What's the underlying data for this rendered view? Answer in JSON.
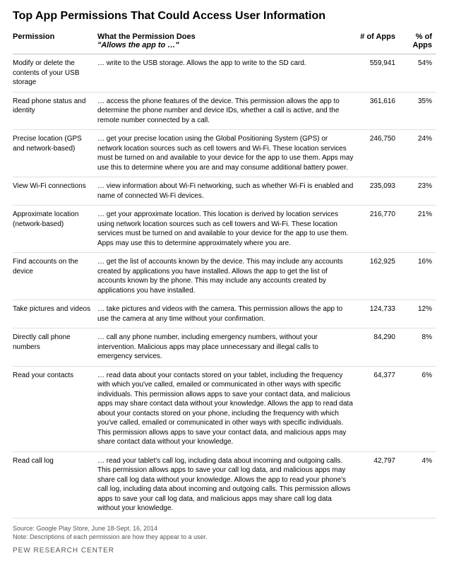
{
  "title": "Top App Permissions That Could Access User Information",
  "headers": {
    "permission": "Permission",
    "does_label": "What the Permission Does",
    "does_sub": "\"Allows the app to …\"",
    "num_apps": "# of Apps",
    "pct_apps": "% of Apps"
  },
  "rows": [
    {
      "permission": "Modify or delete the contents of your USB storage",
      "description": "… write to the USB storage. Allows the app to write to the SD card.",
      "num": "559,941",
      "pct": "54%"
    },
    {
      "permission": "Read phone status and identity",
      "description": "… access the phone features of the device. This permission allows the app to determine the phone number and device IDs, whether a call is active, and the remote number connected by a call.",
      "num": "361,616",
      "pct": "35%"
    },
    {
      "permission": "Precise location (GPS and network-based)",
      "description": "… get your precise location using the Global Positioning System (GPS) or network location sources such as cell towers and Wi-Fi. These location services must be turned on and available to your device for the app to use them. Apps may use this to determine where you are and may consume additional battery power.",
      "num": "246,750",
      "pct": "24%"
    },
    {
      "permission": "View Wi-Fi connections",
      "description": "… view information about Wi-Fi networking, such as whether Wi-Fi is enabled and name of connected Wi-Fi devices.",
      "num": "235,093",
      "pct": "23%"
    },
    {
      "permission": "Approximate location (network-based)",
      "description": "… get your approximate location. This location is derived by location services using network location sources such as cell towers and Wi-Fi. These location services must be turned on and available to your device for the app to use them. Apps may use this to determine approximately where you are.",
      "num": "216,770",
      "pct": "21%"
    },
    {
      "permission": "Find accounts on the device",
      "description": "… get the list of accounts known by the device. This may include any accounts created by applications you have installed. Allows the app to get the list of accounts known by the phone. This may include any accounts created by applications you have installed.",
      "num": "162,925",
      "pct": "16%"
    },
    {
      "permission": "Take pictures and videos",
      "description": "… take pictures and videos with the camera. This permission allows the app to use the camera at any time without your confirmation.",
      "num": "124,733",
      "pct": "12%"
    },
    {
      "permission": "Directly call phone numbers",
      "description": "… call any phone number, including emergency numbers, without your intervention. Malicious apps may place unnecessary and illegal calls to emergency services.",
      "num": "84,290",
      "pct": "8%"
    },
    {
      "permission": "Read your contacts",
      "description": "… read data about your contacts stored on your tablet, including the frequency with which you've called, emailed or communicated in other ways with specific individuals. This permission allows apps to save your contact data, and malicious apps may share contact data without your knowledge. Allows the app to read data about your contacts stored on your phone, including the frequency with which you've called, emailed or communicated in other ways with specific individuals. This permission allows apps to save your contact data, and malicious apps may share contact data without your knowledge.",
      "num": "64,377",
      "pct": "6%"
    },
    {
      "permission": "Read call log",
      "description": "… read your tablet's call log, including data about incoming and outgoing calls. This permission allows apps to save your call log data, and malicious apps may share call log data without your knowledge. Allows the app to read your phone's call log, including data about incoming and outgoing calls. This permission allows apps to save your call log data, and malicious apps may share call log data without your knowledge.",
      "num": "42,797",
      "pct": "4%"
    }
  ],
  "footer": {
    "source": "Source: Google Play Store, June 18-Sept. 16, 2014",
    "note": "Note: Descriptions of each permission are how they appear to a user.",
    "org": "PEW RESEARCH CENTER"
  },
  "chart_data": {
    "type": "table",
    "title": "Top App Permissions That Could Access User Information",
    "columns": [
      "Permission",
      "# of Apps",
      "% of Apps"
    ],
    "rows": [
      [
        "Modify or delete the contents of your USB storage",
        559941,
        54
      ],
      [
        "Read phone status and identity",
        361616,
        35
      ],
      [
        "Precise location (GPS and network-based)",
        246750,
        24
      ],
      [
        "View Wi-Fi connections",
        235093,
        23
      ],
      [
        "Approximate location (network-based)",
        216770,
        21
      ],
      [
        "Find accounts on the device",
        162925,
        16
      ],
      [
        "Take pictures and videos",
        124733,
        12
      ],
      [
        "Directly call phone numbers",
        84290,
        8
      ],
      [
        "Read your contacts",
        64377,
        6
      ],
      [
        "Read call log",
        42797,
        4
      ]
    ]
  }
}
